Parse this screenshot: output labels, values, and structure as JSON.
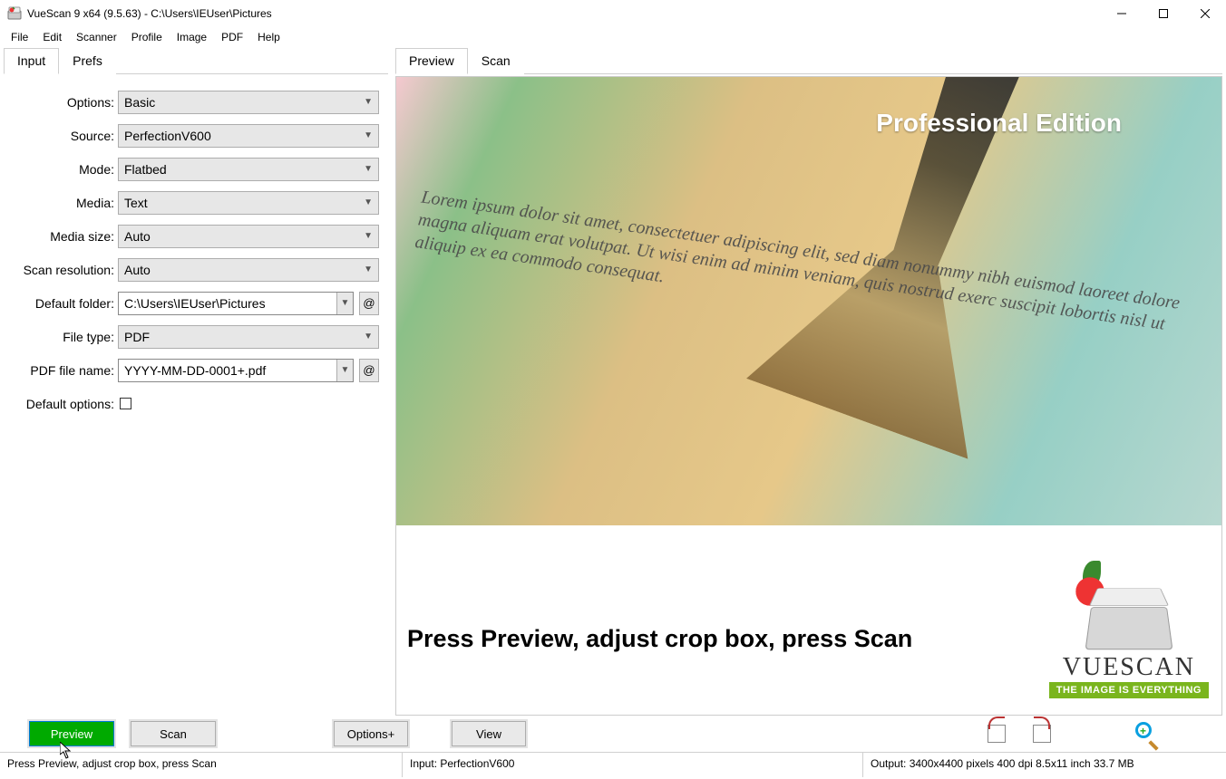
{
  "window": {
    "title": "VueScan 9 x64 (9.5.63) - C:\\Users\\IEUser\\Pictures"
  },
  "menus": [
    "File",
    "Edit",
    "Scanner",
    "Profile",
    "Image",
    "PDF",
    "Help"
  ],
  "leftTabs": {
    "input": "Input",
    "prefs": "Prefs"
  },
  "form": {
    "options": {
      "label": "Options:",
      "value": "Basic"
    },
    "source": {
      "label": "Source:",
      "value": "PerfectionV600"
    },
    "mode": {
      "label": "Mode:",
      "value": "Flatbed"
    },
    "media": {
      "label": "Media:",
      "value": "Text"
    },
    "mediaSize": {
      "label": "Media size:",
      "value": "Auto"
    },
    "scanRes": {
      "label": "Scan resolution:",
      "value": "Auto"
    },
    "defaultFolder": {
      "label": "Default folder:",
      "value": "C:\\Users\\IEUser\\Pictures"
    },
    "fileType": {
      "label": "File type:",
      "value": "PDF"
    },
    "pdfFileName": {
      "label": "PDF file name:",
      "value": "YYYY-MM-DD-0001+.pdf"
    },
    "defaultOptions": {
      "label": "Default options:"
    },
    "atSymbol": "@"
  },
  "rightTabs": {
    "preview": "Preview",
    "scan": "Scan"
  },
  "splash": {
    "edition": "Professional Edition",
    "lorem": "Lorem ipsum dolor sit amet, consectetuer adipiscing elit, sed diam nonummy nibh euismod laoreet dolore magna aliquam erat volutpat. Ut wisi enim ad minim veniam, quis nostrud exerc suscipit lobortis nisl ut aliquip ex ea commodo consequat.",
    "press": "Press Preview, adjust crop box, press Scan",
    "brand": "VUESCAN",
    "tag": "THE IMAGE IS EVERYTHING"
  },
  "buttons": {
    "preview": "Preview",
    "scan": "Scan",
    "options": "Options+",
    "view": "View"
  },
  "status": {
    "hint": "Press Preview, adjust crop box, press Scan",
    "input": "Input: PerfectionV600",
    "output": "Output: 3400x4400 pixels 400 dpi 8.5x11 inch 33.7 MB"
  }
}
